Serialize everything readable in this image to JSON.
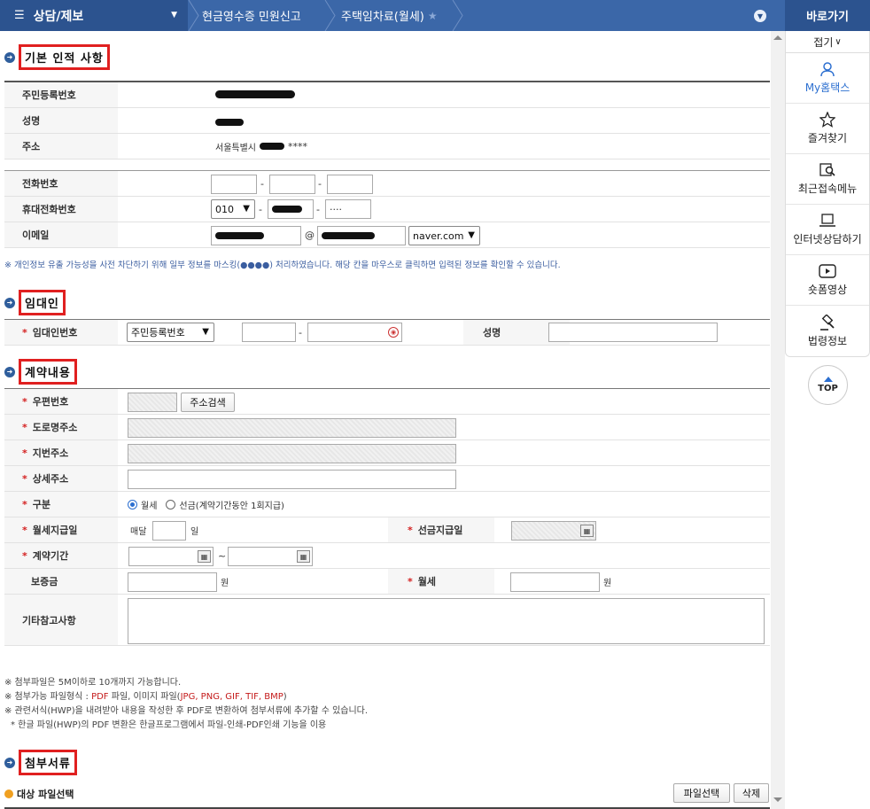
{
  "topbar": {
    "menu_label": "상담/제보",
    "breadcrumb": [
      "현금영수증 민원신고",
      "주택임차료(월세)"
    ],
    "menu_icon": "hamburger-icon",
    "accent": "#3b67a8"
  },
  "sidebar": {
    "title": "바로가기",
    "fold": "접기",
    "items": [
      {
        "label": "My홈택스",
        "icon": "user-icon"
      },
      {
        "label": "즐겨찾기",
        "icon": "star-icon"
      },
      {
        "label": "최근접속메뉴",
        "icon": "recent-search-icon"
      },
      {
        "label": "인터넷상담하기",
        "icon": "laptop-icon"
      },
      {
        "label": "숏폼영상",
        "icon": "play-icon"
      },
      {
        "label": "법령정보",
        "icon": "gavel-icon"
      }
    ],
    "top": "TOP"
  },
  "section1": {
    "title": "기본 인적 사항",
    "rows": {
      "rrn_label": "주민등록번호",
      "name_label": "성명",
      "addr_label": "주소",
      "addr_prefix": "서울특별시",
      "addr_suffix": "****"
    },
    "contact": {
      "phone_label": "전화번호",
      "mobile_label": "휴대전화번호",
      "mobile_prefix": "010",
      "mobile_last": "····",
      "email_label": "이메일",
      "at": "@",
      "domain": "naver.com"
    },
    "notice": "※ 개인정보 유출 가능성을 사전 차단하기 위해 일부 정보를 마스킹(●●●●) 처리하였습니다. 해당 칸을 마우스로 클릭하면 입력된 정보를 확인할 수 있습니다."
  },
  "section2": {
    "title": "임대인",
    "id_label": "임대인번호",
    "id_type": "주민등록번호",
    "name_label": "성명"
  },
  "section3": {
    "title": "계약내용",
    "zip_label": "우편번호",
    "zip_btn": "주소검색",
    "road_label": "도로명주소",
    "jibun_label": "지번주소",
    "detail_label": "상세주소",
    "type_label": "구분",
    "type_monthly": "월세",
    "type_prepaid": "선금(계약기간동안 1회지급)",
    "payday_label": "월세지급일",
    "payday_prefix": "매달",
    "payday_suffix": "일",
    "prepay_label": "선금지급일",
    "period_label": "계약기간",
    "period_sep": "~",
    "deposit_label": "보증금",
    "won": "원",
    "rent_label": "월세",
    "memo_label": "기타참고사항"
  },
  "notes": {
    "n1": "※ 첨부파일은 5M이하로 10개까지 가능합니다.",
    "n2_prefix": "※ 첨부가능 파일형식 : ",
    "n2_pdf": "PDF",
    "n2_mid": " 파일, 이미지 파일(",
    "n2_img": "JPG, PNG, GIF, TIF, BMP",
    "n2_end": ")",
    "n3": "※ 관련서식(HWP)을 내려받아 내용을 작성한 후 PDF로 변환하여 첨부서류에 추가할 수 있습니다.",
    "n4": "* 한글 파일(HWP)의 PDF 변환은 한글프로그램에서 파일-인쇄-PDF인쇄 기능을 이용"
  },
  "section4": {
    "title": "첨부서류",
    "target_label": "대상 파일선택",
    "select_btn": "파일선택",
    "delete_btn": "삭제"
  }
}
